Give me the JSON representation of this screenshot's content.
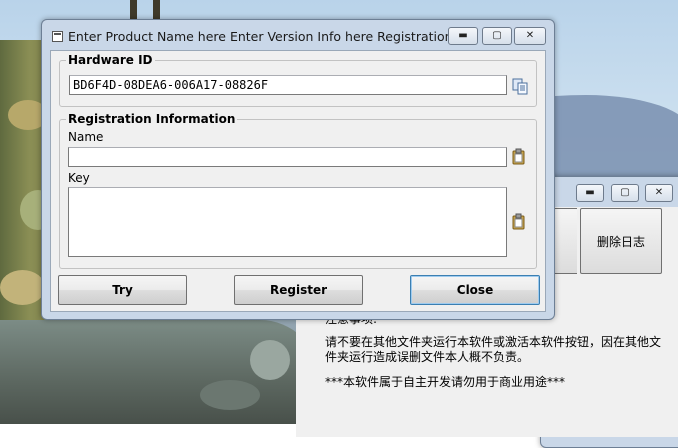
{
  "main_window": {
    "title": "Enter Product Name here Enter Version Info here Registration ...",
    "hardware_group": {
      "legend": "Hardware ID",
      "value": "BD6F4D-08DEA6-006A17-08826F"
    },
    "registration_group": {
      "legend": "Registration Information",
      "name_label": "Name",
      "name_value": "",
      "key_label": "Key",
      "key_value": ""
    },
    "buttons": {
      "try": "Try",
      "register": "Register",
      "close": "Close"
    },
    "controls": {
      "minimize": "▬",
      "maximize": "▢",
      "close": "✕"
    }
  },
  "back_window": {
    "delete_log_button": "删除日志",
    "notes_heading": "注意事项:",
    "notes_line1": "请不要在其他文件夹运行本软件或激活本软件按钮，因在其他文件夹运行造成误删文件本人概不负责。",
    "notes_line2": "***本软件属于自主开发请勿用于商业用途***",
    "controls": {
      "minimize": "▬",
      "maximize": "▢",
      "close": "✕"
    }
  },
  "colors": {
    "title_bar": "#c9d7e8",
    "client": "#f0f0f0",
    "focus_border": "#3c7fb1"
  },
  "icons": {
    "copy": "copy-icon",
    "paste_name": "paste-icon",
    "paste_key": "paste-icon"
  }
}
